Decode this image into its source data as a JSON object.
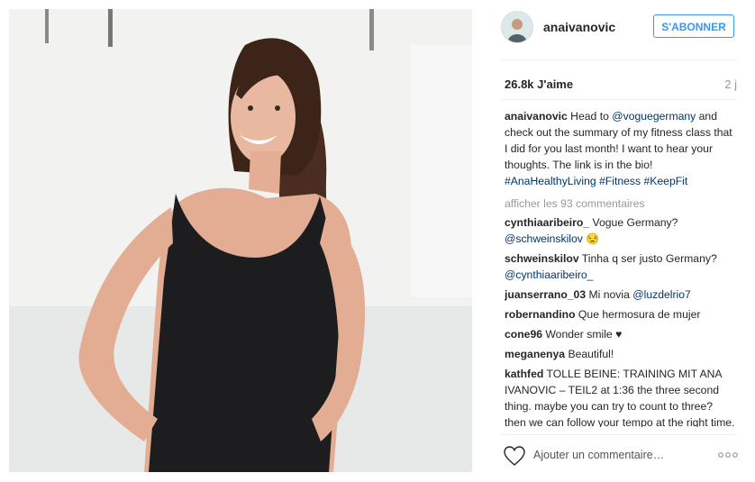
{
  "post": {
    "username": "anaivanovic",
    "follow_label": "S'ABONNER",
    "likes": "26.8k J'aime",
    "time": "2 j",
    "caption": {
      "username": "anaivanovic",
      "part1": " Head to ",
      "mention": "@voguegermany",
      "part2": " and check out the summary of my fitness class that I did for you last month! I want to hear your thoughts. The link is in the bio! ",
      "tags": [
        "#AnaHealthyLiving",
        "#Fitness",
        "#KeepFit"
      ]
    },
    "view_all": "afficher les 93 commentaires",
    "comments": [
      {
        "username": "cynthiaaribeiro_",
        "text_before": " Vogue Germany? ",
        "mention": "@schweinskilov",
        "text_after": " 😒"
      },
      {
        "username": "schweinskilov",
        "text_before": " Tinha q ser justo Germany? ",
        "mention": "@cynthiaaribeiro_",
        "text_after": ""
      },
      {
        "username": "juanserrano_03",
        "text_before": " Mi novia ",
        "mention": "@luzdelrio7",
        "text_after": ""
      },
      {
        "username": "robernandino",
        "text_before": " Que hermosura de mujer",
        "mention": "",
        "text_after": ""
      },
      {
        "username": "cone96",
        "text_before": " Wonder smile ♥",
        "mention": "",
        "text_after": ""
      },
      {
        "username": "meganenya",
        "text_before": " Beautiful!",
        "mention": "",
        "text_after": ""
      },
      {
        "username": "kathfed",
        "text_before": " TOLLE BEINE: TRAINING MIT ANA IVANOVIC – TEIL2 at 1:36 the three second thing. maybe you can try to count to three? then we can follow your tempo at the right time. its really perfect though not much to",
        "mention": "",
        "text_after": ""
      }
    ],
    "add_comment_placeholder": "Ajouter un commentaire…",
    "icons": {
      "like": "heart-outline-icon",
      "more": "more-options-icon"
    },
    "colors": {
      "accent": "#3897f0",
      "link": "#003569",
      "muted": "#999999"
    }
  }
}
